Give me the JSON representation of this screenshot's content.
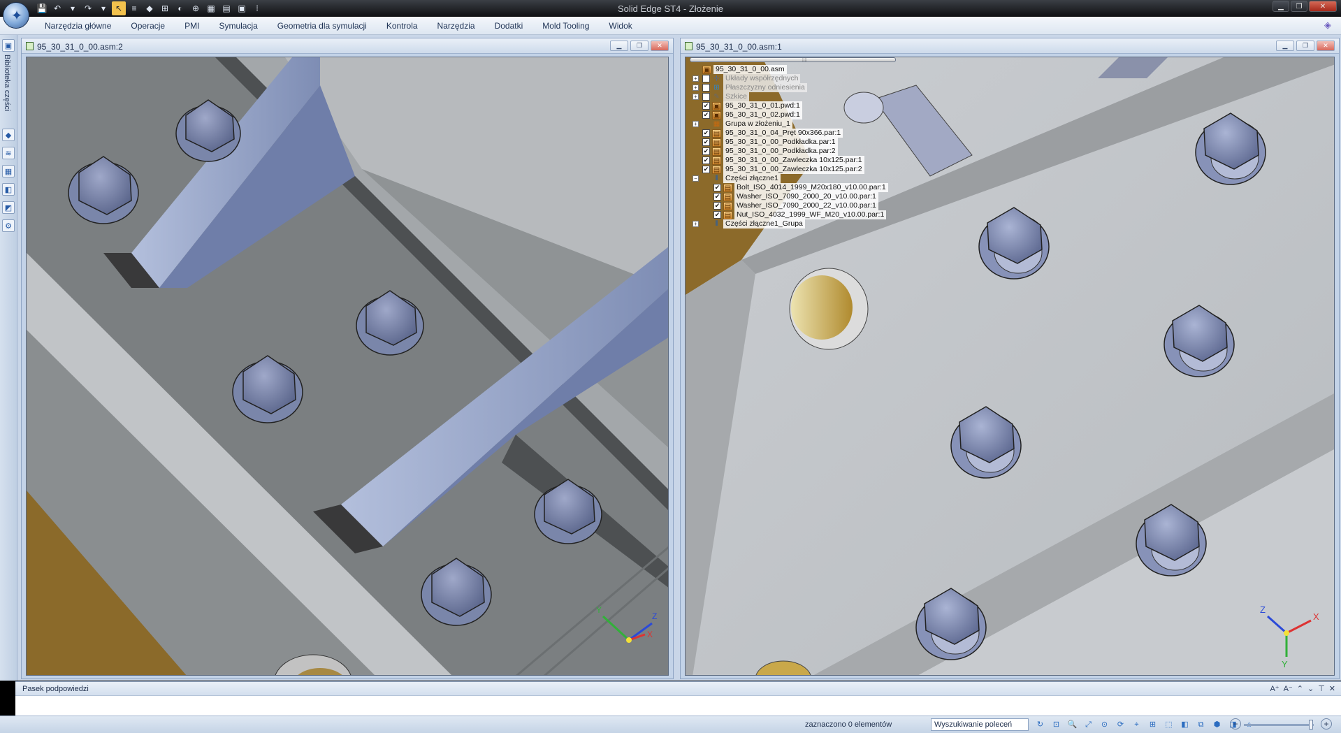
{
  "app": {
    "window_title": "Solid Edge ST4 - Złożenie",
    "logo_glyph": "✦"
  },
  "quick_access": [
    {
      "name": "save-icon",
      "glyph": "💾"
    },
    {
      "name": "undo-icon",
      "glyph": "↶"
    },
    {
      "name": "dropdown-icon",
      "glyph": "▾"
    },
    {
      "name": "redo-icon",
      "glyph": "↷"
    },
    {
      "name": "dropdown-icon",
      "glyph": "▾"
    },
    {
      "name": "select-tool-icon",
      "glyph": "↖"
    },
    {
      "name": "grid-icon",
      "glyph": "≡"
    },
    {
      "name": "red-diamond-icon",
      "glyph": "◆"
    },
    {
      "name": "tree-icon",
      "glyph": "⊞"
    },
    {
      "name": "view-icon",
      "glyph": "◐"
    },
    {
      "name": "insert-icon",
      "glyph": "⊕"
    },
    {
      "name": "table-icon",
      "glyph": "▦"
    },
    {
      "name": "layout-icon",
      "glyph": "▤"
    },
    {
      "name": "window-icon",
      "glyph": "▣"
    },
    {
      "name": "customize-icon",
      "glyph": "⁞"
    }
  ],
  "menu": [
    "Narzędzia główne",
    "Operacje",
    "PMI",
    "Symulacja",
    "Geometria dla symulacji",
    "Kontrola",
    "Narzędzia",
    "Dodatki",
    "Mold Tooling",
    "Widok"
  ],
  "left_dock": {
    "label": "Biblioteka części",
    "icons": [
      "library-icon",
      "parts-icon",
      "layers-icon",
      "features-icon",
      "render-icon",
      "settings-icon"
    ]
  },
  "window_left": {
    "title": "95_30_31_0_00.asm:2",
    "triad": {
      "x": "X",
      "y": "Y",
      "z": "Z"
    }
  },
  "window_right": {
    "title": "95_30_31_0_00.asm:1",
    "triad": {
      "x": "X",
      "y": "Y",
      "z": "Z"
    },
    "tree": [
      {
        "label": "95_30_31_0_00.asm",
        "level": 0,
        "expander": "",
        "check": "none",
        "icon": "ic-asm",
        "dim": false
      },
      {
        "label": "Układy współrzędnych",
        "level": 1,
        "expander": "+",
        "check": "empty",
        "icon": "ic-coord",
        "dim": true
      },
      {
        "label": "Płaszczyzny odniesienia",
        "level": 1,
        "expander": "+",
        "check": "empty",
        "icon": "ic-plane",
        "dim": true
      },
      {
        "label": "Szkice",
        "level": 1,
        "expander": "+",
        "check": "empty",
        "icon": "ic-sketch",
        "dim": true
      },
      {
        "label": "95_30_31_0_01.pwd:1",
        "level": 1,
        "expander": "",
        "check": "checked",
        "icon": "ic-asm",
        "dim": false
      },
      {
        "label": "95_30_31_0_02.pwd:1",
        "level": 1,
        "expander": "",
        "check": "checked",
        "icon": "ic-asm",
        "dim": false
      },
      {
        "label": "Grupa w złożeniu_1",
        "level": 1,
        "expander": "+",
        "check": "none",
        "icon": "ic-group",
        "dim": false
      },
      {
        "label": "95_30_31_0_04_Pręt 90x366.par:1",
        "level": 1,
        "expander": "",
        "check": "checked",
        "icon": "ic-part",
        "dim": false
      },
      {
        "label": "95_30_31_0_00_Podkładka.par:1",
        "level": 1,
        "expander": "",
        "check": "checked",
        "icon": "ic-part",
        "dim": false
      },
      {
        "label": "95_30_31_0_00_Podkładka.par:2",
        "level": 1,
        "expander": "",
        "check": "checked",
        "icon": "ic-part",
        "dim": false
      },
      {
        "label": "95_30_31_0_00_Zawleczka 10x125.par:1",
        "level": 1,
        "expander": "",
        "check": "checked",
        "icon": "ic-part",
        "dim": false
      },
      {
        "label": "95_30_31_0_00_Zawleczka 10x125.par:2",
        "level": 1,
        "expander": "",
        "check": "checked",
        "icon": "ic-part",
        "dim": false
      },
      {
        "label": "Części złączne1",
        "level": 1,
        "expander": "−",
        "check": "none",
        "icon": "ic-fast",
        "dim": false
      },
      {
        "label": "Bolt_ISO_4014_1999_M20x180_v10.00.par:1",
        "level": 2,
        "expander": "",
        "check": "checked",
        "icon": "ic-part",
        "dim": false
      },
      {
        "label": "Washer_ISO_7090_2000_20_v10.00.par:1",
        "level": 2,
        "expander": "",
        "check": "checked",
        "icon": "ic-part",
        "dim": false
      },
      {
        "label": "Washer_ISO_7090_2000_22_v10.00.par:1",
        "level": 2,
        "expander": "",
        "check": "checked",
        "icon": "ic-part",
        "dim": false
      },
      {
        "label": "Nut_ISO_4032_1999_WF_M20_v10.00.par:1",
        "level": 2,
        "expander": "",
        "check": "checked",
        "icon": "ic-part",
        "dim": false
      },
      {
        "label": "Części złączne1_Grupa",
        "level": 1,
        "expander": "+",
        "check": "none",
        "icon": "ic-fast",
        "dim": false
      }
    ]
  },
  "prompt": {
    "title": "Pasek podpowiedzi",
    "tools": [
      "A⁺",
      "A⁻",
      "⌃",
      "⌄",
      "⊤",
      "✕"
    ]
  },
  "status": {
    "selection_text": "zaznaczono 0 elementów",
    "command_search": "Wyszukiwanie poleceń",
    "zoom_minus": "−",
    "zoom_plus": "+",
    "zoom_level": 0.96,
    "view_tools": [
      "↻",
      "⊡",
      "🔍",
      "⤢",
      "⊙",
      "⟳",
      "⌖",
      "⊞",
      "⬚",
      "◧",
      "⧉",
      "⬢",
      "◨",
      "⌂"
    ]
  },
  "colors": {
    "plate_dark": "#9a9ea0",
    "plate_light": "#c4c6ca",
    "steel_blue": "#8e9cc4",
    "bronze": "#8d6b2e"
  }
}
